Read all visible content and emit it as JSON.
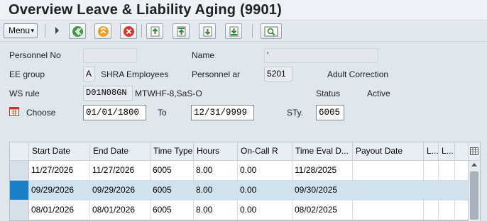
{
  "title": "Overview Leave & Liability Aging (9901)",
  "toolbar": {
    "menu_label": "Menu",
    "menu_caret": "▾",
    "icons": [
      "back-icon",
      "exit-icon",
      "cancel-icon",
      "upload-icon",
      "first-page-icon",
      "download-icon",
      "last-page-icon",
      "find-icon"
    ]
  },
  "form": {
    "personnel_no_label": "Personnel No",
    "personnel_no_value": "",
    "name_label": "Name",
    "name_value": "'",
    "ee_group_label": "EE group",
    "ee_group_code": "A",
    "ee_group_text": "SHRA Employees",
    "personnel_area_label": "Personnel ar",
    "personnel_area_code": "5201",
    "personnel_area_text": "Adult Correction",
    "ws_rule_label": "WS rule",
    "ws_rule_code": "D01N08GN",
    "ws_rule_text": "MTWHF-8,SaS-O",
    "status_label": "Status",
    "status_value": "Active",
    "choose_label": "Choose",
    "from_date": "01/01/1800",
    "to_label": "To",
    "to_date": "12/31/9999",
    "sty_label": "STy.",
    "sty_value": "6005"
  },
  "table": {
    "columns": [
      "Start Date",
      "End Date",
      "Time Type",
      "Hours",
      "On-Call R",
      "Time Eval D...",
      "Payout Date",
      "L...",
      "L..."
    ],
    "rows": [
      [
        "11/27/2026",
        "11/27/2026",
        "6005",
        "8.00",
        "0.00",
        "11/28/2025",
        "",
        "",
        ""
      ],
      [
        "09/29/2026",
        "09/29/2026",
        "6005",
        "8.00",
        "0.00",
        "09/30/2025",
        "",
        "",
        ""
      ],
      [
        "08/01/2026",
        "08/01/2026",
        "6005",
        "8.00",
        "0.00",
        "08/02/2025",
        "",
        "",
        ""
      ]
    ],
    "selected_row": 1
  },
  "colors": {
    "selection": "#1a7fc4",
    "selected_row_bg": "#cfe3ee"
  }
}
